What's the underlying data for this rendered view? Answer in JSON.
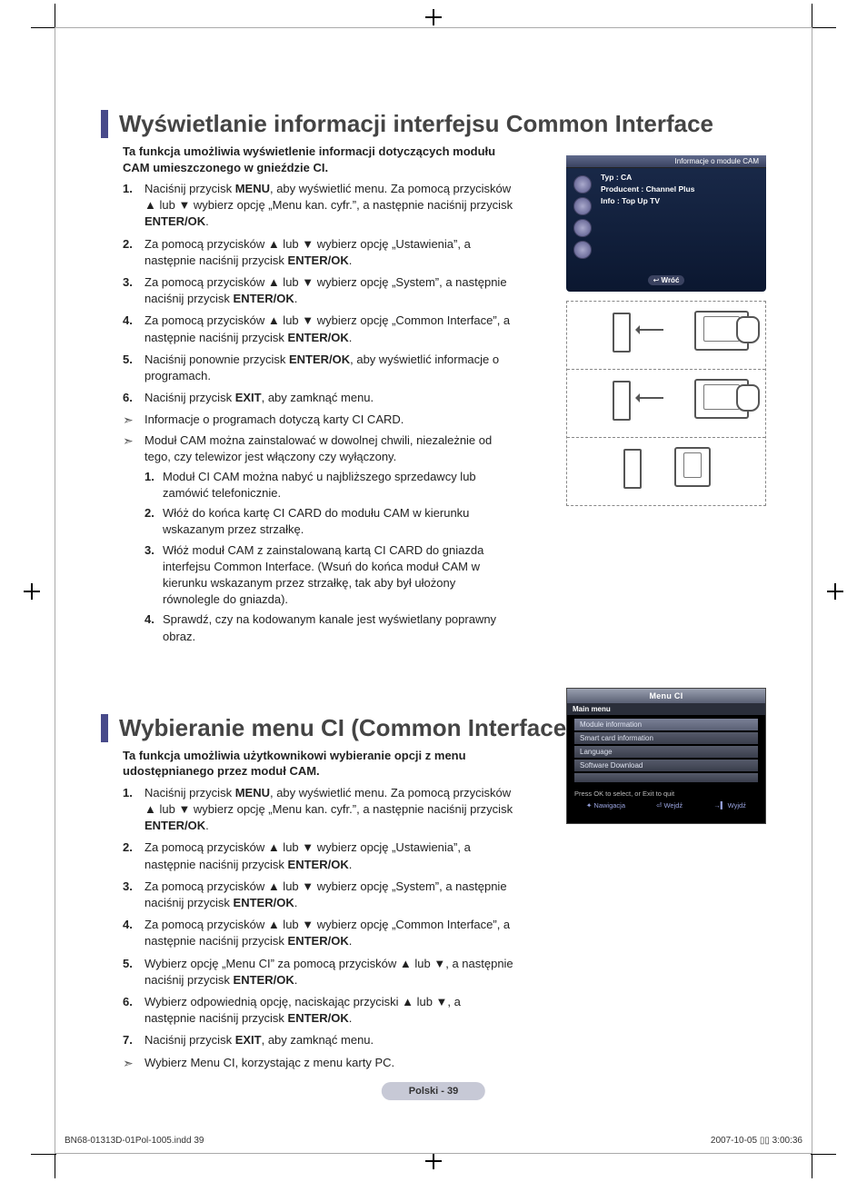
{
  "crop": {},
  "section1": {
    "title": "Wyświetlanie informacji interfejsu Common Interface",
    "lead": "Ta funkcja umożliwia wyświetlenie informacji dotyczących modułu CAM umieszczonego w gnieździe CI.",
    "steps": [
      "Naciśnij przycisk <b>MENU</b>, aby wyświetlić menu. Za pomocą przycisków ▲ lub ▼ wybierz opcję „Menu kan. cyfr.”, a następnie naciśnij przycisk <b>ENTER/OK</b>.",
      "Za pomocą przycisków ▲ lub ▼ wybierz opcję „Ustawienia”, a następnie naciśnij przycisk <b>ENTER/OK</b>.",
      "Za pomocą przycisków ▲ lub ▼ wybierz opcję „System”, a następnie naciśnij przycisk <b>ENTER/OK</b>.",
      "Za pomocą przycisków ▲ lub ▼ wybierz opcję „Common Interface”, a następnie naciśnij przycisk <b>ENTER/OK</b>.",
      "Naciśnij ponownie przycisk <b>ENTER/OK</b>, aby wyświetlić informacje o programach.",
      "Naciśnij przycisk <b>EXIT</b>, aby zamknąć menu."
    ],
    "note1": "Informacje o programach dotyczą karty CI CARD.",
    "note2": "Moduł CAM można zainstalować w dowolnej chwili, niezależnie od tego, czy telewizor jest włączony czy wyłączony.",
    "sub": [
      "Moduł CI CAM można nabyć u najbliższego sprzedawcy lub zamówić telefonicznie.",
      "Włóż do końca kartę CI CARD do modułu CAM w kierunku wskazanym przez strzałkę.",
      "Włóż moduł CAM z zainstalowaną kartą CI CARD do gniazda interfejsu Common Interface. (Wsuń do końca moduł CAM w kierunku wskazanym przez strzałkę, tak aby był ułożony równolegle do gniazda).",
      "Sprawdź, czy na kodowanym kanale jest wyświetlany poprawny obraz."
    ]
  },
  "osd1": {
    "header": "Informacje o module CAM",
    "line1": "Typ : CA",
    "line2": "Producent : Channel Plus",
    "line3": "Info : Top Up TV",
    "back_icon": "↩",
    "back": "Wróć"
  },
  "section2": {
    "title": "Wybieranie menu CI (Common Interface)",
    "lead": "Ta funkcja umożliwia użytkownikowi wybieranie opcji z menu udostępnianego przez moduł CAM.",
    "steps": [
      "Naciśnij przycisk <b>MENU</b>, aby wyświetlić menu. Za pomocą przycisków ▲ lub ▼ wybierz opcję „Menu kan. cyfr.”, a następnie naciśnij przycisk <b>ENTER/OK</b>.",
      "Za pomocą przycisków ▲ lub ▼ wybierz opcję „Ustawienia”, a następnie naciśnij przycisk <b>ENTER/OK</b>.",
      "Za pomocą przycisków ▲ lub ▼ wybierz opcję „System”, a następnie naciśnij przycisk <b>ENTER/OK</b>.",
      "Za pomocą przycisków ▲ lub ▼ wybierz opcję „Common Interface”, a następnie naciśnij przycisk <b>ENTER/OK</b>.",
      "Wybierz opcję „Menu CI” za pomocą przycisków ▲ lub ▼, a następnie naciśnij przycisk <b>ENTER/OK</b>.",
      "Wybierz odpowiednią opcję, naciskając przyciski ▲ lub ▼, a następnie naciśnij przycisk <b>ENTER/OK</b>.",
      "Naciśnij przycisk <b>EXIT</b>, aby zamknąć menu."
    ],
    "note": "Wybierz Menu CI, korzystając z menu karty PC."
  },
  "osd2": {
    "title": "Menu CI",
    "main": "Main menu",
    "items": [
      "Module information",
      "Smart card information",
      "Language",
      "Software Download"
    ],
    "hint": "Press OK to select, or Exit to quit",
    "foot_nav_icon": "✦",
    "foot_nav": "Nawigacja",
    "foot_enter_icon": "⏎",
    "foot_enter": "Wejdź",
    "foot_exit_icon": "→▍",
    "foot_exit": "Wyjdź"
  },
  "footer": {
    "pill": "Polski - 39",
    "left": "BN68-01313D-01Pol-1005.indd   39",
    "right_date": "2007-10-05",
    "right_time": "3:00:36",
    "right_sep": "   ▯▯ "
  }
}
